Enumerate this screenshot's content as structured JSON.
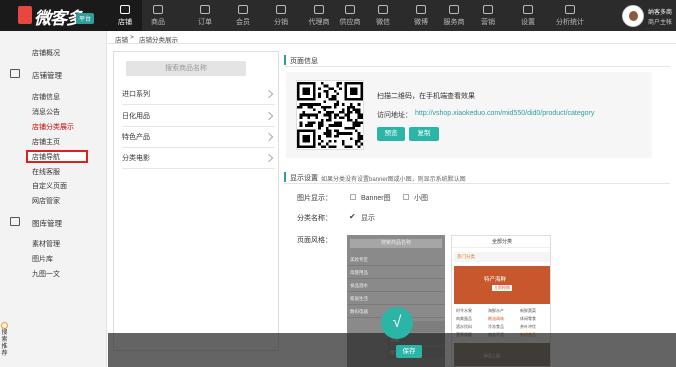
{
  "brand": {
    "name": "微客多",
    "badge": "平台",
    "tagline": "微信营销"
  },
  "topnav": [
    {
      "label": "店铺",
      "icon": "store-icon",
      "active": true
    },
    {
      "label": "商品",
      "icon": "goods-icon"
    },
    {
      "label": "订单",
      "icon": "order-icon"
    },
    {
      "label": "会员",
      "icon": "member-icon"
    },
    {
      "label": "分销",
      "icon": "distribution-icon"
    },
    {
      "label": "代理商",
      "icon": "agent-icon"
    },
    {
      "label": "供应商",
      "icon": "supplier-icon"
    },
    {
      "label": "微信",
      "icon": "wechat-icon"
    },
    {
      "label": "微博",
      "icon": "weibo-icon"
    },
    {
      "label": "服务商",
      "icon": "service-icon"
    },
    {
      "label": "营销",
      "icon": "marketing-icon"
    },
    {
      "label": "设置",
      "icon": "settings-icon"
    },
    {
      "label": "分析统计",
      "icon": "analytics-icon"
    }
  ],
  "user": {
    "name": "纳客多商",
    "role": "商户主帐"
  },
  "sidebar": {
    "overview": "店铺概况",
    "shop_mgmt": "店铺管理",
    "shop_items": [
      "店铺信息",
      "消息公告",
      "店铺分类展示",
      "店铺主页",
      "店铺导航",
      "在线客服",
      "自定义页面",
      "网店管家"
    ],
    "gallery_mgmt": "图库管理",
    "gallery_items": [
      "素材管理",
      "图片库",
      "九图一文"
    ],
    "float": [
      "搜",
      "索",
      "推",
      "荐"
    ]
  },
  "breadcrumb": {
    "root": "店铺",
    "sep": ">",
    "current": "店铺分类展示"
  },
  "category_panel": {
    "search_placeholder": "搜索商品名称",
    "items": [
      "进口系列",
      "日化用品",
      "特色产品",
      "分类电影"
    ]
  },
  "page_info": {
    "title": "页面信息",
    "scan_text": "扫描二维码，在手机端查看效果",
    "url_label": "访问地址：",
    "url": "http://vshop.xiaokeduo.com/mid550/did0/product/category",
    "preview_btn": "预览",
    "copy_btn": "复制"
  },
  "display": {
    "title": "显示设置",
    "hint": "如果分类没有设置banner图或小图，则显示系统默认图",
    "image_label": "图片显示：",
    "opt_banner": "Banner图",
    "opt_small": "小图",
    "name_label": "分类名称：",
    "opt_show": "显示",
    "style_label": "页面风格："
  },
  "preview1": {
    "search": "搜索商品名称",
    "rows": [
      "美妆专区",
      "母婴用品",
      "食品酒水",
      "家居生活",
      "数码电器"
    ],
    "subs": [
      "面膜",
      "洁面",
      "精华"
    ]
  },
  "preview2": {
    "title": "全部分类",
    "tab": "热门分类",
    "banner_title": "特产海鲜",
    "banner_btn": "立即抢购",
    "grid": [
      "时令水果",
      "海鲜水产",
      "新鲜蔬菜",
      "肉禽蛋品",
      "粮油调味",
      "休闲零食",
      "酒水饮料",
      "冷冻食品",
      "茶叶冲饮",
      "营养保健",
      "南北干货",
      "有机食品"
    ],
    "footer_text": "新品上架"
  },
  "footer": {
    "save_btn": "保存",
    "fab_glyph": "√"
  }
}
